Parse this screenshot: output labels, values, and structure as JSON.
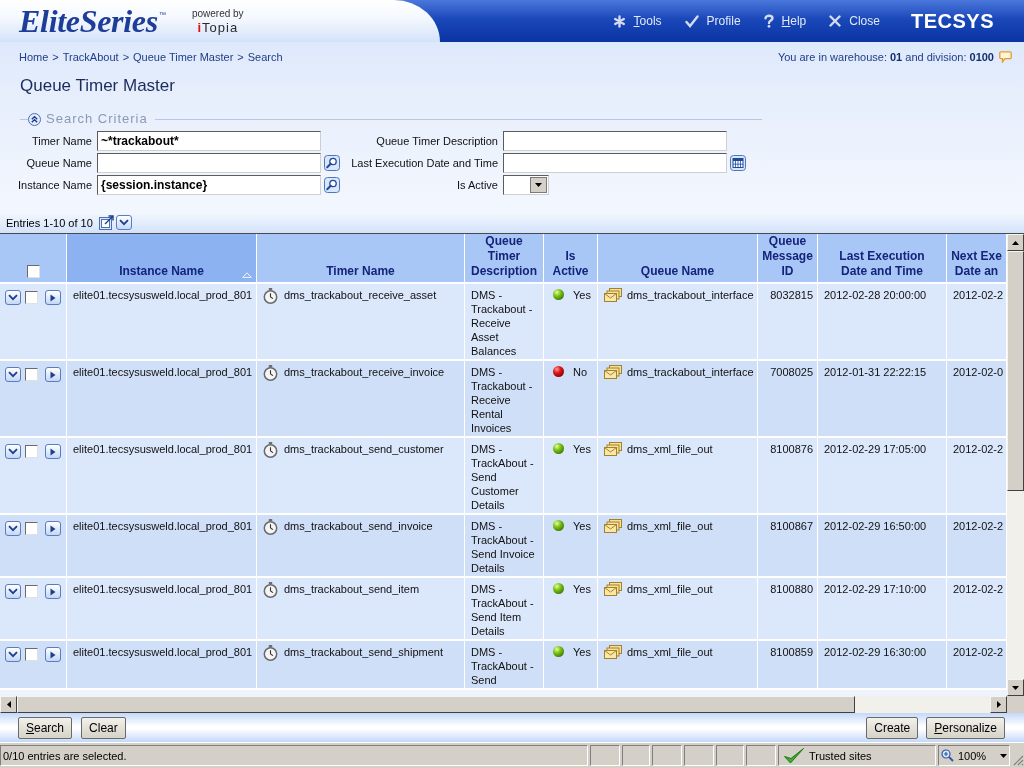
{
  "header": {
    "logo": "EliteSeries",
    "trademark": "™",
    "tagline": "powered by",
    "partner": "iTopia",
    "nav": [
      {
        "kind": "tools",
        "label": "Tools",
        "mnemonic": true
      },
      {
        "kind": "profile",
        "label": "Profile",
        "mnemonic": false
      },
      {
        "kind": "help",
        "label": "Help",
        "mnemonic": true
      },
      {
        "kind": "close",
        "label": "Close",
        "mnemonic": false
      }
    ],
    "brand": "TECSYS"
  },
  "breadcrumb": {
    "separator": ">",
    "items": [
      "Home",
      "TrackAbout",
      "Queue Timer Master",
      "Search"
    ]
  },
  "location": "You are in warehouse: **01** and division: **0100**",
  "page_title": "Queue Timer Master",
  "search_criteria": {
    "legend": "Search Criteria",
    "expanded": true,
    "fields": [
      {
        "label": "Timer Name",
        "kind": "text",
        "value": "~*trackabout*"
      },
      {
        "label": "Queue Timer Description",
        "kind": "text"
      },
      {
        "label": "Queue Name",
        "kind": "lookup"
      },
      {
        "label": "Last Execution Date and Time",
        "kind": "date"
      },
      {
        "label": "Instance Name",
        "kind": "lookup",
        "value": "{session.instance}"
      },
      {
        "label": "Is Active",
        "kind": "select"
      }
    ]
  },
  "list_bar": {
    "entries": "Entries 1-10 of 10"
  },
  "table": {
    "select_all_checked": false,
    "columns": [
      {
        "label": "Instance Name",
        "sorted": true
      },
      {
        "label": "Timer Name",
        "sorted": false
      },
      {
        "label": "Queue Timer Description",
        "sorted": false
      },
      {
        "label": "Is Active",
        "sorted": false
      },
      {
        "label": "Queue Name",
        "sorted": false
      },
      {
        "label": "Queue Message ID",
        "sorted": false
      },
      {
        "label": "Last Execution Date and Time",
        "sorted": false
      },
      {
        "label": "Next Exe\nDate an",
        "sorted": false
      }
    ],
    "rows": [
      {
        "checked": false,
        "instance": "elite01.tecsysusweld.local_prod_801",
        "timer": "dms_trackabout_receive_asset",
        "description": "DMS - Trackabout - Receive Asset Balances",
        "active": true,
        "active_text": "Yes",
        "queue": "dms_trackabout_interface",
        "message_id": "8032815",
        "last_execution": "2012-02-28 20:00:00",
        "next_execution": "2012-02-2"
      },
      {
        "checked": false,
        "instance": "elite01.tecsysusweld.local_prod_801",
        "timer": "dms_trackabout_receive_invoice",
        "description": "DMS - Trackabout - Receive Rental Invoices",
        "active": false,
        "active_text": "No",
        "queue": "dms_trackabout_interface",
        "message_id": "7008025",
        "last_execution": "2012-01-31 22:22:15",
        "next_execution": "2012-02-0"
      },
      {
        "checked": false,
        "instance": "elite01.tecsysusweld.local_prod_801",
        "timer": "dms_trackabout_send_customer",
        "description": "DMS - TrackAbout - Send Customer Details",
        "active": true,
        "active_text": "Yes",
        "queue": "dms_xml_file_out",
        "message_id": "8100876",
        "last_execution": "2012-02-29 17:05:00",
        "next_execution": "2012-02-2"
      },
      {
        "checked": false,
        "instance": "elite01.tecsysusweld.local_prod_801",
        "timer": "dms_trackabout_send_invoice",
        "description": "DMS - TrackAbout - Send Invoice Details",
        "active": true,
        "active_text": "Yes",
        "queue": "dms_xml_file_out",
        "message_id": "8100867",
        "last_execution": "2012-02-29 16:50:00",
        "next_execution": "2012-02-2"
      },
      {
        "checked": false,
        "instance": "elite01.tecsysusweld.local_prod_801",
        "timer": "dms_trackabout_send_item",
        "description": "DMS - TrackAbout - Send Item Details",
        "active": true,
        "active_text": "Yes",
        "queue": "dms_xml_file_out",
        "message_id": "8100880",
        "last_execution": "2012-02-29 17:10:00",
        "next_execution": "2012-02-2"
      },
      {
        "checked": false,
        "instance": "elite01.tecsysusweld.local_prod_801",
        "timer": "dms_trackabout_send_shipment",
        "description": "DMS - TrackAbout - Send",
        "active": true,
        "active_text": "Yes",
        "queue": "dms_xml_file_out",
        "message_id": "8100859",
        "last_execution": "2012-02-29 16:30:00",
        "next_execution": "2012-02-2"
      }
    ]
  },
  "actions": {
    "left": [
      {
        "label": "Search",
        "mnemonic": true
      },
      {
        "label": "Clear",
        "mnemonic": false
      }
    ],
    "right": [
      {
        "label": "Create",
        "mnemonic": false
      },
      {
        "label": "Personalize",
        "mnemonic": true
      }
    ]
  },
  "status_bar": {
    "message": "0/10 entries are selected.",
    "zone": "Trusted sites",
    "zoom": "100%"
  }
}
